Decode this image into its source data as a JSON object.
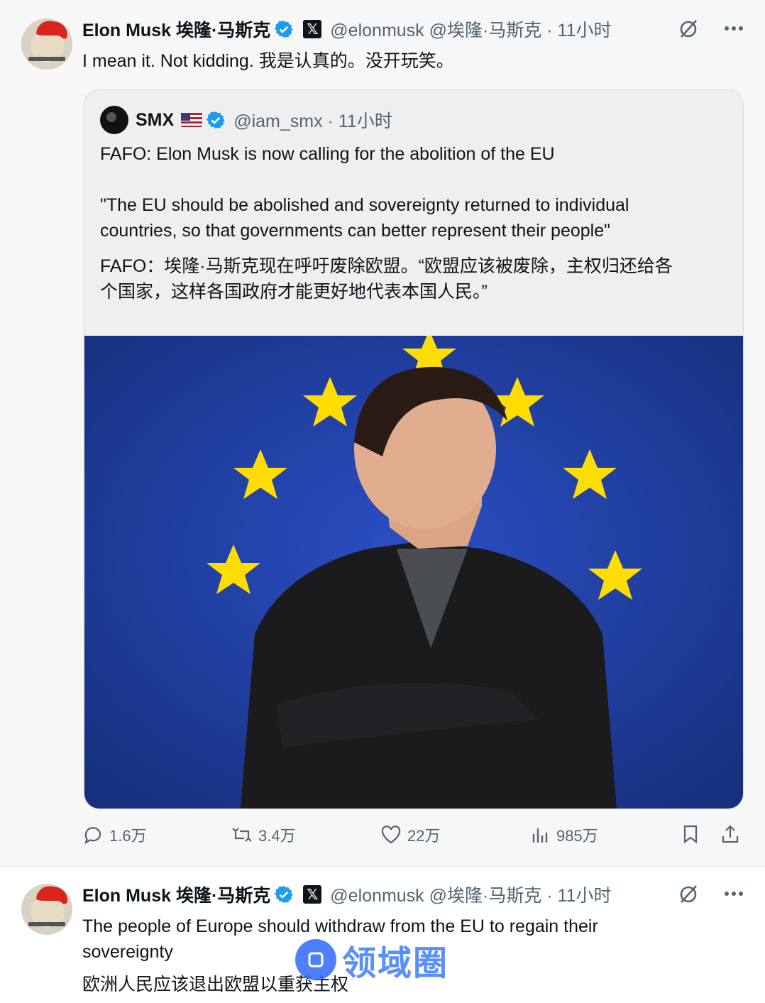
{
  "tweet1": {
    "author_name": "Elon Musk 埃隆·马斯克",
    "handle": "@elonmusk @埃隆·马斯克 · 11小时",
    "x_badge": "𝕏",
    "text": "I mean it. Not kidding. 我是认真的。没开玩笑。",
    "quote": {
      "author_name": "SMX",
      "handle": "@iam_smx · 11小时",
      "line1": "FAFO: Elon Musk is now calling for the abolition of the EU",
      "line2": "\"The EU should be abolished and sovereignty returned to individual",
      "line3": "countries, so that governments can better represent their people\"",
      "line4": "FAFO：埃隆·马斯克现在呼吁废除欧盟。“欧盟应该被废除，主权归还给各",
      "line5": "个国家，这样各国政府才能更好地代表本国人民。”"
    },
    "actions": {
      "replies": "1.6万",
      "retweets": "3.4万",
      "likes": "22万",
      "views": "985万"
    }
  },
  "tweet2": {
    "author_name": "Elon Musk 埃隆·马斯克",
    "handle": "@elonmusk @埃隆·马斯克 · 11小时",
    "x_badge": "𝕏",
    "line1": "The people of Europe should withdraw from the EU to regain their",
    "line2": "sovereignty",
    "line3": "欧洲人民应该退出欧盟以重获主权",
    "watermark": "领域圈"
  },
  "colors": {
    "verified": "#1d9bf0",
    "muted": "#536471",
    "eu_blue": "#1f3fa8",
    "eu_star": "#ffdd00"
  }
}
